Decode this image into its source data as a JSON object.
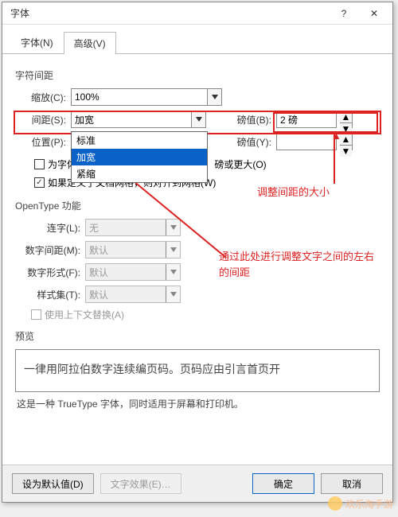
{
  "window": {
    "title": "字体"
  },
  "tabs": {
    "font": "字体(N)",
    "advanced": "高级(V)"
  },
  "sections": {
    "spacing": "字符间距",
    "opentype": "OpenType 功能",
    "preview": "预览"
  },
  "labels": {
    "scale": "缩放(C):",
    "spacing": "间距(S):",
    "position": "位置(P):",
    "points1": "磅值(B):",
    "points2": "磅值(Y):",
    "pointsOrMore": "磅或更大(O)",
    "ligature": "连字(L):",
    "numSpacing": "数字间距(M):",
    "numForm": "数字形式(F):",
    "styleSet": "样式集(T):"
  },
  "values": {
    "scale": "100%",
    "spacing": "加宽",
    "position": "",
    "pointVal": "2 磅",
    "ligature": "无",
    "numSpacing": "默认",
    "numForm": "默认",
    "styleSet": "默认"
  },
  "dropdown": {
    "opt0": "标准",
    "opt1": "加宽",
    "opt2": "紧缩"
  },
  "checkboxes": {
    "kerning": "为字体调整字间距(K):",
    "snapGrid": "如果定义了文档网格，则对齐到网格(W)",
    "contextAlt": "使用上下文替换(A)"
  },
  "annotations": {
    "a1": "调整间距的大小",
    "a2": "通过此处进行调整文字之间的左右的间距"
  },
  "preview": {
    "text": "一律用阿拉伯数字连续编页码。页码应由引言首页开",
    "hint": "这是一种 TrueType 字体，同时适用于屏幕和打印机。"
  },
  "buttons": {
    "default": "设为默认值(D)",
    "textfx": "文字效果(E)…",
    "ok": "确定",
    "cancel": "取消"
  },
  "watermark": "欢乐淘手游"
}
